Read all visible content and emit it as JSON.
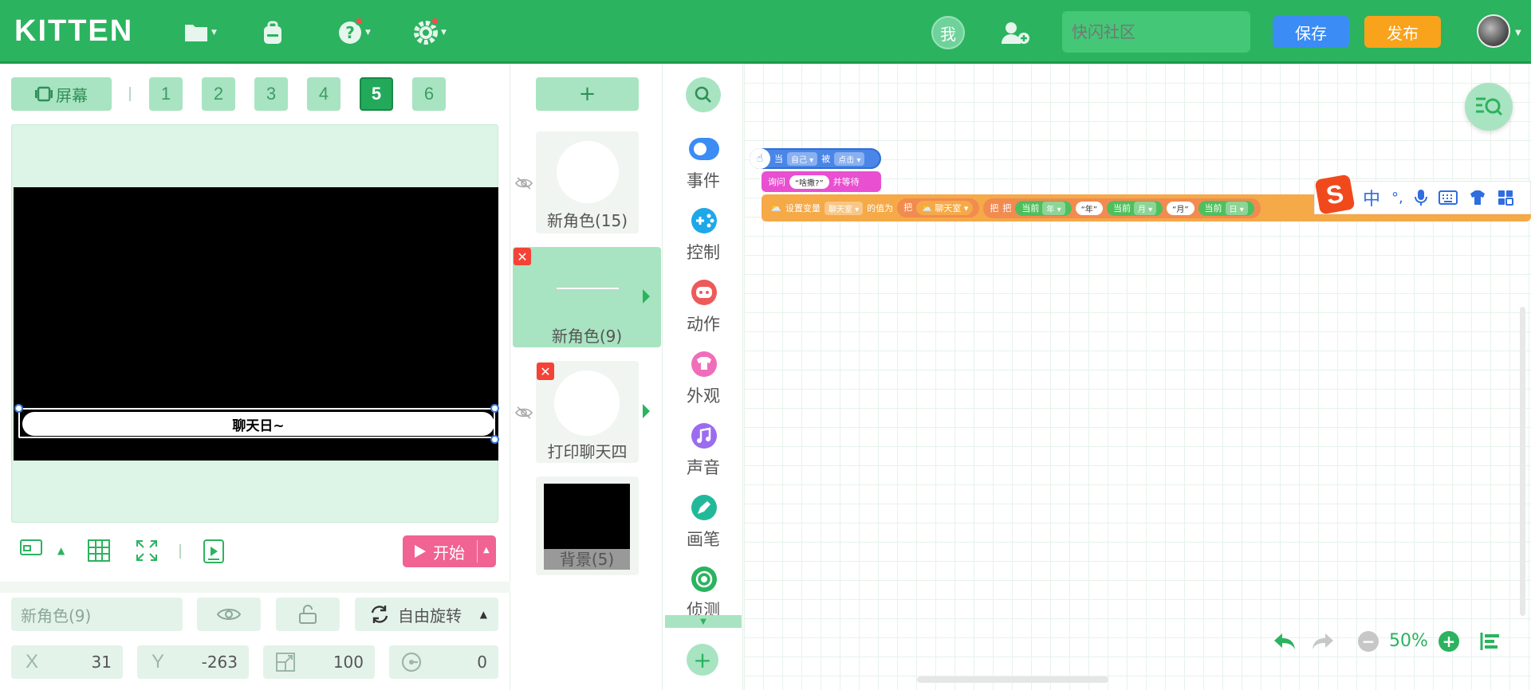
{
  "app": {
    "logo": "KITTEN"
  },
  "header": {
    "me_label": "我",
    "community_placeholder": "快闪社区",
    "save_label": "保存",
    "publish_label": "发布"
  },
  "stage": {
    "screen_button": "屏幕",
    "scenes": [
      "1",
      "2",
      "3",
      "4",
      "5",
      "6"
    ],
    "active_scene": "5",
    "chat_text": "聊天日~",
    "start_label": "开始"
  },
  "props": {
    "sprite_name": "新角色(9)",
    "rotation_mode": "自由旋转",
    "x_label": "X",
    "x_value": "31",
    "y_label": "Y",
    "y_value": "-263",
    "size_value": "100",
    "direction_value": "0"
  },
  "sprites": {
    "add_label": "+",
    "items": [
      {
        "name": "新角色(15)"
      },
      {
        "name": "新角色(9)"
      },
      {
        "name": "打印聊天四"
      },
      {
        "name": "背景(5)"
      }
    ]
  },
  "categories": [
    {
      "label": "事件",
      "color": "#3b8cf5"
    },
    {
      "label": "控制",
      "color": "#1ea7e9"
    },
    {
      "label": "动作",
      "color": "#ee5a5a"
    },
    {
      "label": "外观",
      "color": "#f06dba"
    },
    {
      "label": "声音",
      "color": "#9b6cf0"
    },
    {
      "label": "画笔",
      "color": "#22b99a"
    },
    {
      "label": "侦测",
      "color": "#2bb35f"
    }
  ],
  "blocks": {
    "event": {
      "when": "当",
      "target": "自己",
      "is": "被",
      "action": "点击"
    },
    "ask": {
      "label": "询问",
      "question": "“啥撒?”",
      "wait": "并等待"
    },
    "setvar": {
      "label": "设置变量",
      "var": "聊天室",
      "to": "的值为",
      "join1": "把",
      "varref": "聊天室",
      "join2": "把",
      "join3": "把",
      "cur1": "当前",
      "year": "年",
      "lit_year": "“年”",
      "cur2": "当前",
      "month": "月",
      "lit_month": "“月”",
      "cur3": "当前",
      "day": "日"
    }
  },
  "ime": {
    "lang": "中",
    "punct": "°,"
  },
  "zoom": {
    "level": "50%"
  }
}
